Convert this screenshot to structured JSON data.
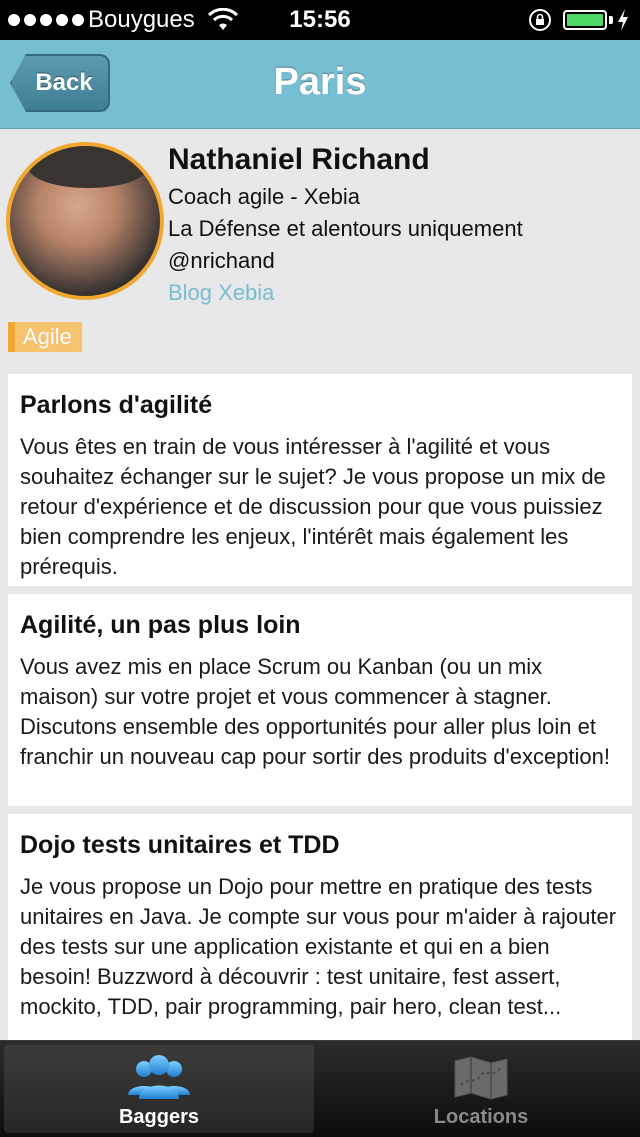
{
  "status_bar": {
    "carrier": "Bouygues",
    "time": "15:56",
    "battery_level": 1.0
  },
  "nav": {
    "back_label": "Back",
    "title": "Paris"
  },
  "profile": {
    "name": "Nathaniel Richand",
    "role": "Coach agile - Xebia",
    "location": "La Défense et alentours uniquement",
    "handle": "@nrichand",
    "blog_label": "Blog Xebia",
    "tag": "Agile"
  },
  "sessions": [
    {
      "title": "Parlons d'agilité",
      "description": "Vous êtes en train de vous intéresser à l'agilité et vous souhaitez échanger sur le sujet? Je vous propose un mix de retour d'expérience et de discussion pour que vous puissiez bien comprendre les enjeux, l'intérêt mais également les prérequis."
    },
    {
      "title": "Agilité, un pas plus loin",
      "description": "Vous avez mis en place Scrum ou Kanban (ou un mix maison) sur votre projet et vous commencer à stagner. Discutons ensemble des opportunités pour aller plus loin et franchir un nouveau cap pour sortir des produits d'exception!"
    },
    {
      "title": "Dojo tests unitaires et TDD",
      "description": "Je vous propose un Dojo pour mettre en pratique des tests unitaires en Java. Je compte sur vous pour m'aider à rajouter des tests sur une application existante et qui en a bien besoin! Buzzword à découvrir : test unitaire, fest assert, mockito, TDD, pair programming, pair hero, clean test..."
    }
  ],
  "tabs": [
    {
      "label": "Baggers",
      "icon": "people-icon",
      "selected": true
    },
    {
      "label": "Locations",
      "icon": "map-icon",
      "selected": false
    }
  ],
  "colors": {
    "nav_bar": "#78bed2",
    "accent_orange": "#f0a830",
    "link": "#78bed2",
    "tab_active_icon": "#3aa3e0"
  }
}
